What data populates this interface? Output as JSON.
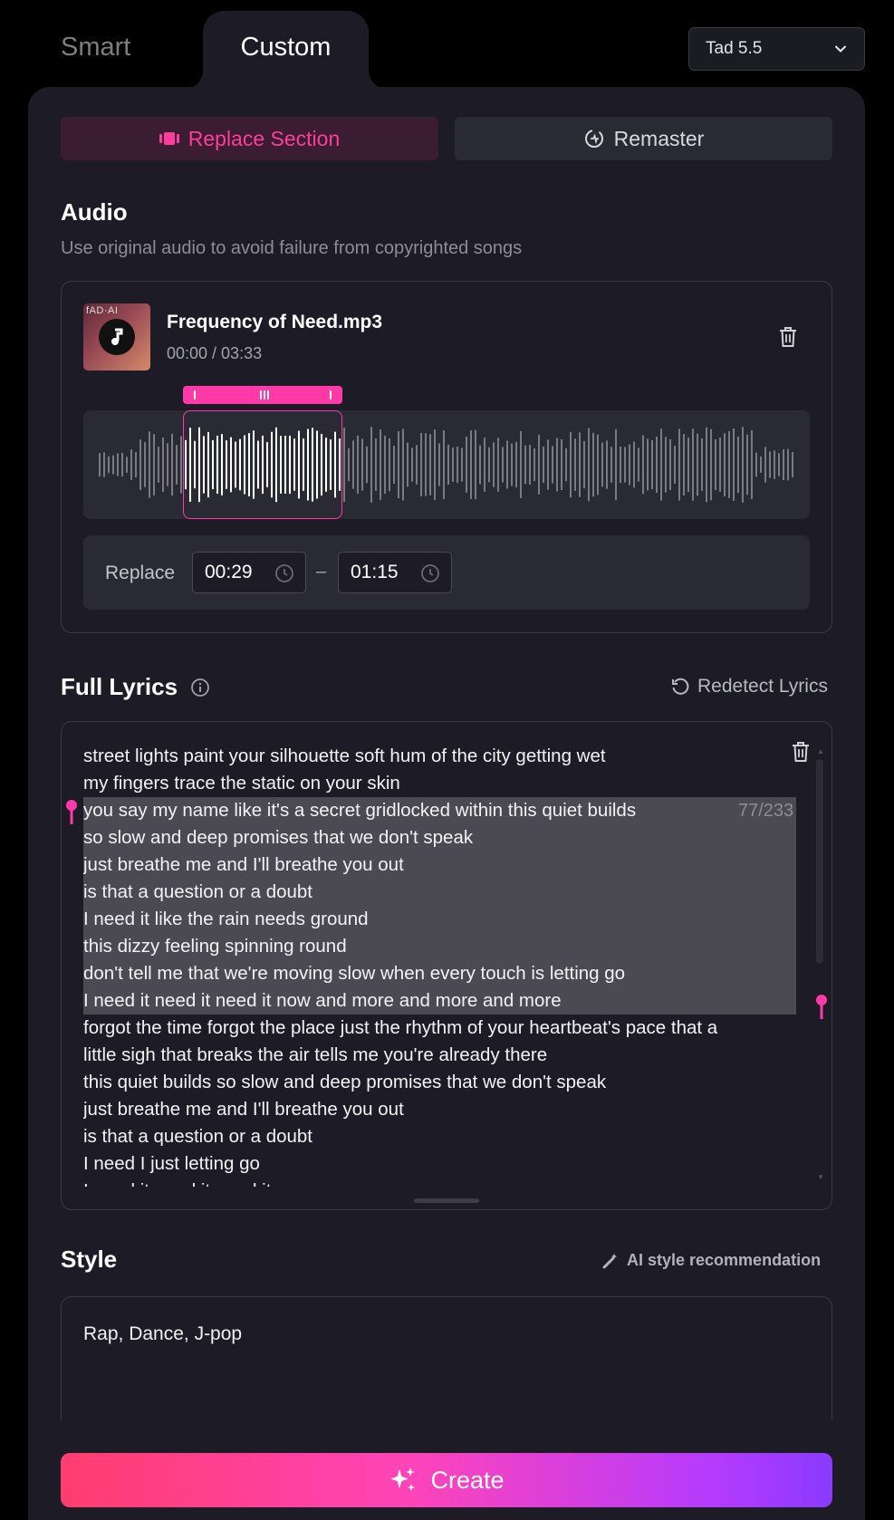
{
  "tabs": {
    "smart": "Smart",
    "custom": "Custom"
  },
  "model": {
    "selected": "Tad 5.5"
  },
  "modes": {
    "replace": "Replace Section",
    "remaster": "Remaster"
  },
  "audio": {
    "heading": "Audio",
    "subtitle": "Use original audio to avoid failure from copyrighted songs",
    "cover_text": "fAD·AI",
    "file_name": "Frequency of Need.mp3",
    "time": "00:00 / 03:33",
    "replace_label": "Replace",
    "start": "00:29",
    "end": "01:15",
    "dash": "–"
  },
  "lyrics": {
    "heading": "Full Lyrics",
    "redetect": "Redetect Lyrics",
    "counter": "77/233",
    "lines": [
      "street lights paint your silhouette soft hum of the city getting wet",
      "my fingers trace the static on your skin",
      "you say my name like it's a secret gridlocked within this quiet builds",
      "so slow and deep promises that we don't speak",
      "just breathe me and I'll breathe you out",
      "is that a question or a doubt",
      "I need it like the rain needs ground",
      "this dizzy feeling spinning round",
      "don't tell me that we're moving slow when every touch is letting go",
      "I need it need it need it now and more and more and more",
      "forgot the time forgot the place just the rhythm of your heartbeat's pace that a",
      "little sigh that breaks the air tells me you're already there",
      "this quiet builds so slow and deep promises that we don't speak",
      "just breathe me and I'll breathe you out",
      "is that a question or a doubt",
      "I need I just letting go",
      "I need it need it need it"
    ]
  },
  "style": {
    "heading": "Style",
    "ai_recommend": "AI style recommendation",
    "value": "Rap, Dance, J-pop"
  },
  "create": {
    "label": "Create"
  },
  "colors": {
    "accent": "#ff3aa8",
    "panel": "#1d1c26",
    "field": "#2a2a35"
  }
}
